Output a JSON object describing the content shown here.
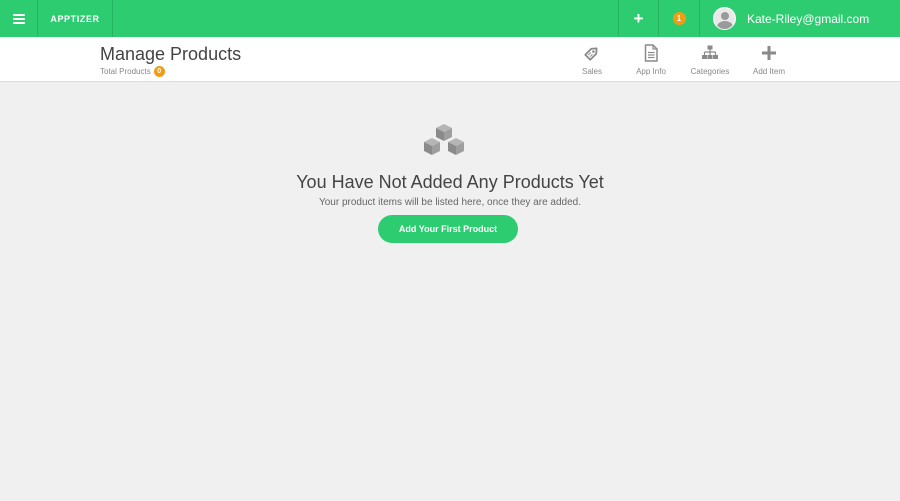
{
  "topbar": {
    "brand": "APPTIZER",
    "plus_label": "+",
    "notification_count": "1",
    "user_email": "Kate-Riley@gmail.com"
  },
  "header": {
    "title": "Manage Products",
    "total_label": "Total Products",
    "total_count": "0",
    "tools": [
      {
        "label": "Sales",
        "icon": "tag-icon"
      },
      {
        "label": "App Info",
        "icon": "document-icon"
      },
      {
        "label": "Categories",
        "icon": "sitemap-icon"
      },
      {
        "label": "Add Item",
        "icon": "plus-icon"
      }
    ]
  },
  "empty_state": {
    "icon": "cubes-icon",
    "title": "You Have Not Added Any Products Yet",
    "subtitle": "Your product items will be listed here, once they are added.",
    "button_label": "Add Your First Product"
  },
  "colors": {
    "brand_green": "#2ecc71",
    "badge_orange": "#f39c12",
    "background": "#f0f0f0"
  }
}
